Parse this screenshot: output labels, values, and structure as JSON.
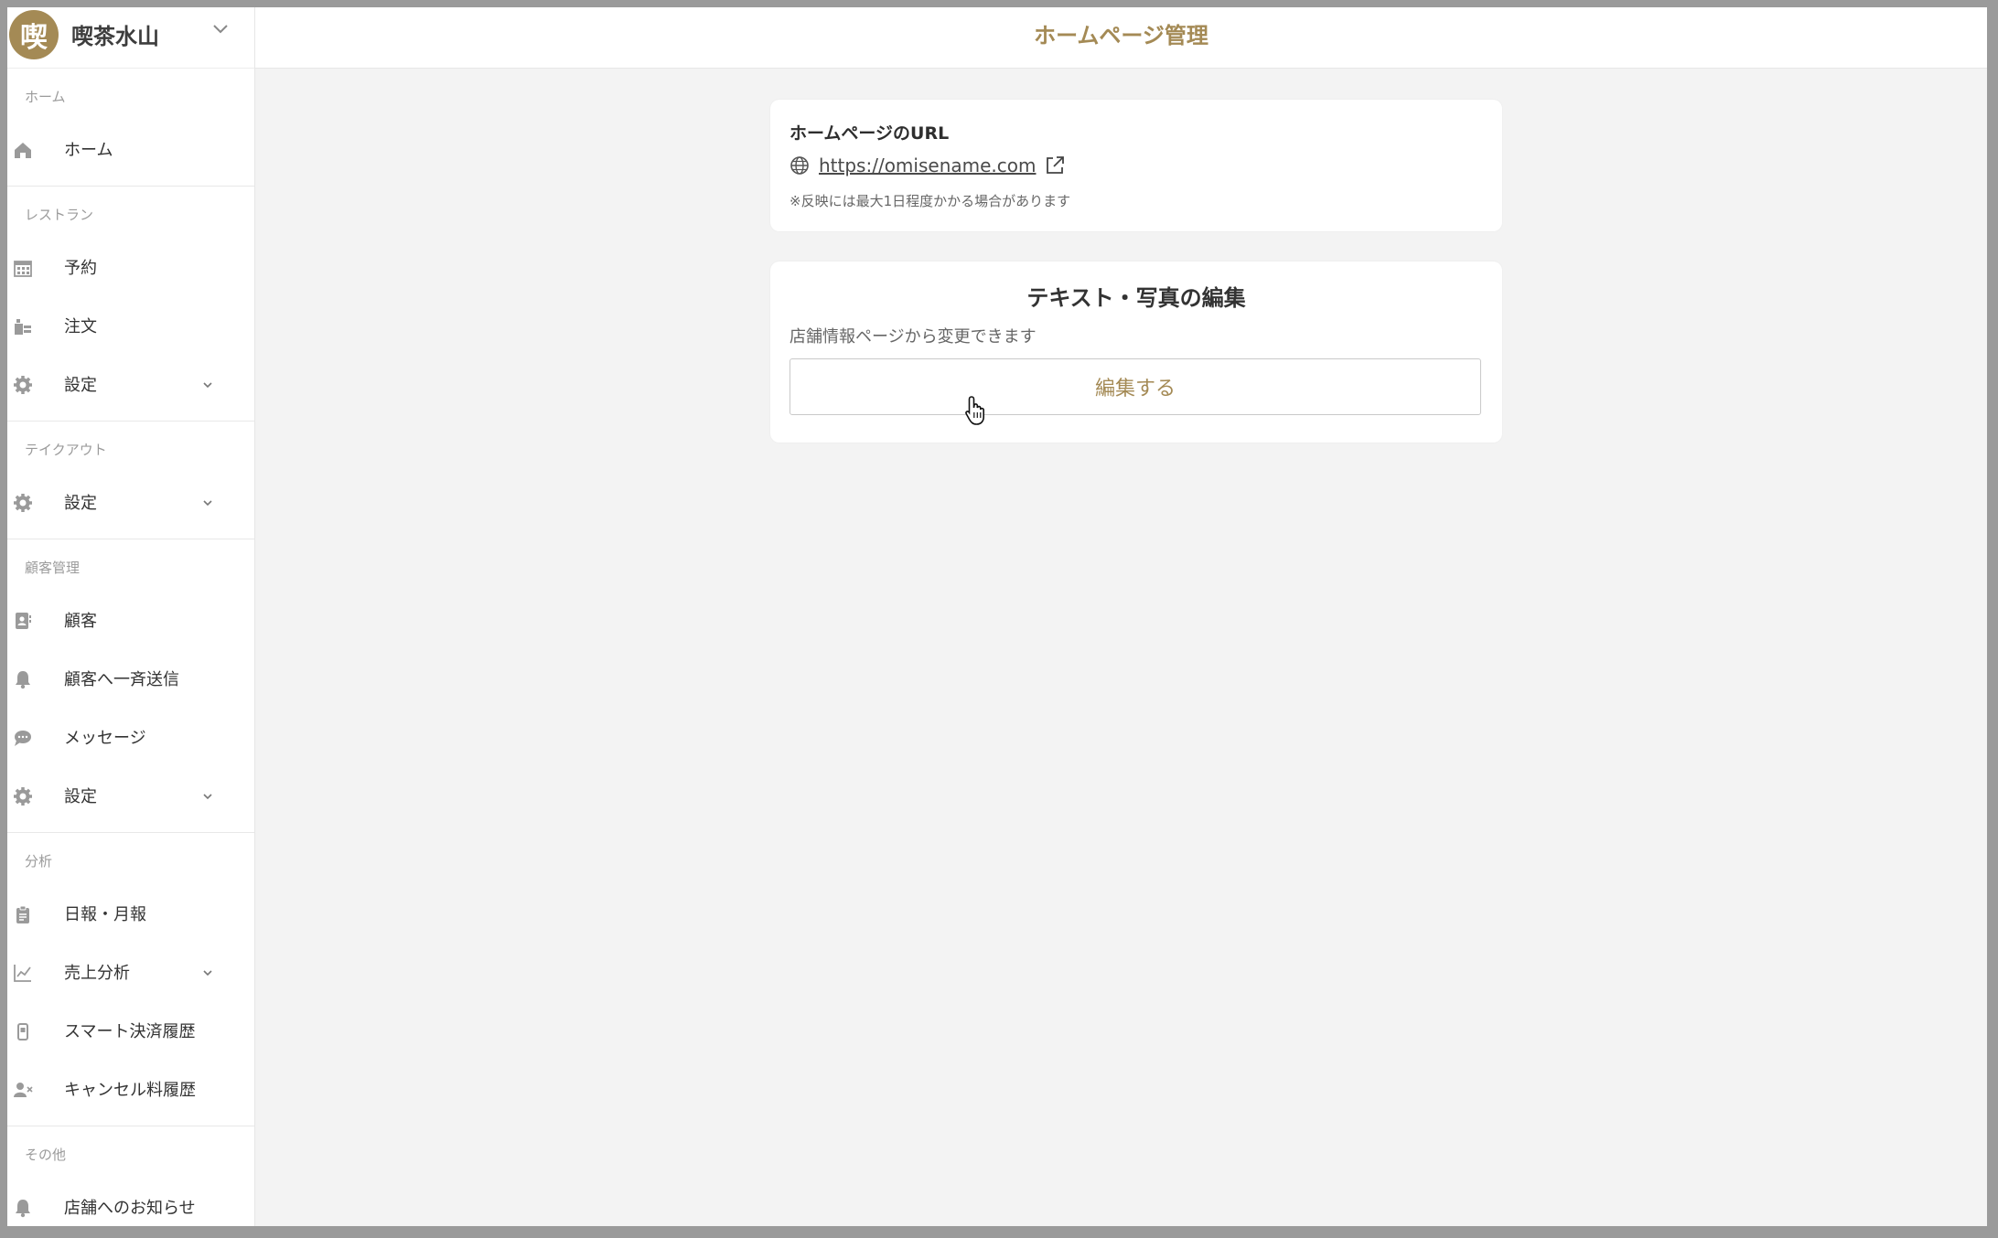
{
  "sidebar": {
    "brand": {
      "logo_char": "喫",
      "name": "喫茶水山"
    },
    "sections": [
      {
        "label": "ホーム",
        "items": [
          {
            "label": "ホーム",
            "icon": "home-icon",
            "expandable": false
          }
        ]
      },
      {
        "label": "レストラン",
        "items": [
          {
            "label": "予約",
            "icon": "calendar-icon",
            "expandable": false
          },
          {
            "label": "注文",
            "icon": "order-icon",
            "expandable": false
          },
          {
            "label": "設定",
            "icon": "gear-icon",
            "expandable": true
          }
        ]
      },
      {
        "label": "テイクアウト",
        "items": [
          {
            "label": "設定",
            "icon": "gear-icon",
            "expandable": true
          }
        ]
      },
      {
        "label": "顧客管理",
        "items": [
          {
            "label": "顧客",
            "icon": "contact-card-icon",
            "expandable": false
          },
          {
            "label": "顧客へ一斉送信",
            "icon": "bell-icon",
            "expandable": false
          },
          {
            "label": "メッセージ",
            "icon": "chat-icon",
            "expandable": false
          },
          {
            "label": "設定",
            "icon": "gear-icon",
            "expandable": true
          }
        ]
      },
      {
        "label": "分析",
        "items": [
          {
            "label": "日報・月報",
            "icon": "clipboard-icon",
            "expandable": false
          },
          {
            "label": "売上分析",
            "icon": "line-chart-icon",
            "expandable": true
          },
          {
            "label": "スマート決済履歴",
            "icon": "phone-icon",
            "expandable": false
          },
          {
            "label": "キャンセル料履歴",
            "icon": "user-x-icon",
            "expandable": false
          }
        ]
      },
      {
        "label": "その他",
        "items": [
          {
            "label": "店舗へのお知らせ",
            "icon": "bell-icon",
            "expandable": false
          }
        ]
      }
    ]
  },
  "header": {
    "title": "ホームページ管理"
  },
  "url_card": {
    "title": "ホームページのURL",
    "url": "https://omisename.com",
    "note": "※反映には最大1日程度かかる場合があります"
  },
  "edit_card": {
    "title": "テキスト・写真の編集",
    "subtitle": "店舗情報ページから変更できます",
    "button_label": "編集する"
  },
  "colors": {
    "accent": "#a48a55",
    "background": "#f3f3f3",
    "text": "#333333"
  }
}
